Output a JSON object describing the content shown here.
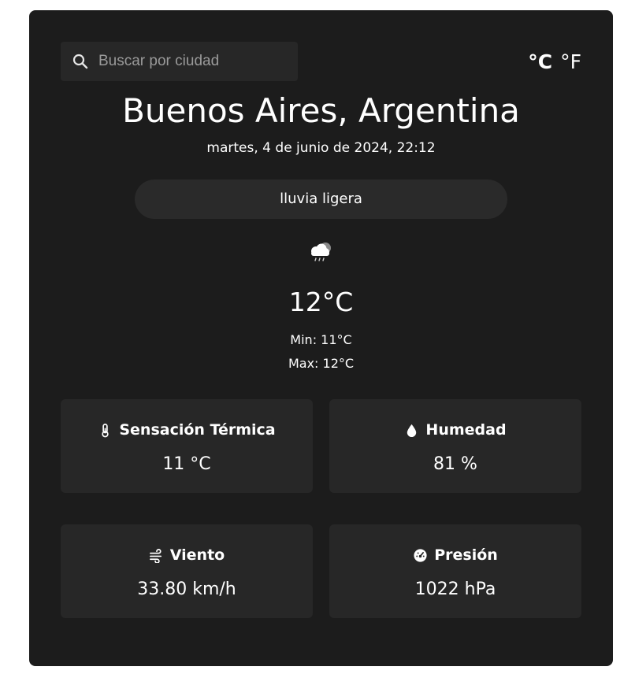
{
  "search": {
    "placeholder": "Buscar por ciudad",
    "value": ""
  },
  "units": {
    "celsius": "°C",
    "fahrenheit": "°F",
    "active": "celsius"
  },
  "location": {
    "name": "Buenos Aires, Argentina"
  },
  "datetime": "martes, 4 de junio de 2024, 22:12",
  "condition": {
    "description": "lluvia ligera",
    "icon": "cloud-rain-icon"
  },
  "temperature": {
    "current": "12°C",
    "min": "Min: 11°C",
    "max": "Max: 12°C"
  },
  "details": {
    "feels_like": {
      "label": "Sensación Térmica",
      "value": "11 °C",
      "icon": "thermometer-icon"
    },
    "humidity": {
      "label": "Humedad",
      "value": "81 %",
      "icon": "droplet-icon"
    },
    "wind": {
      "label": "Viento",
      "value": "33.80 km/h",
      "icon": "wind-icon"
    },
    "pressure": {
      "label": "Presión",
      "value": "1022 hPa",
      "icon": "gauge-icon"
    }
  },
  "colors": {
    "card": "#1c1c1c",
    "tile": "#272727",
    "text": "#ffffff"
  }
}
